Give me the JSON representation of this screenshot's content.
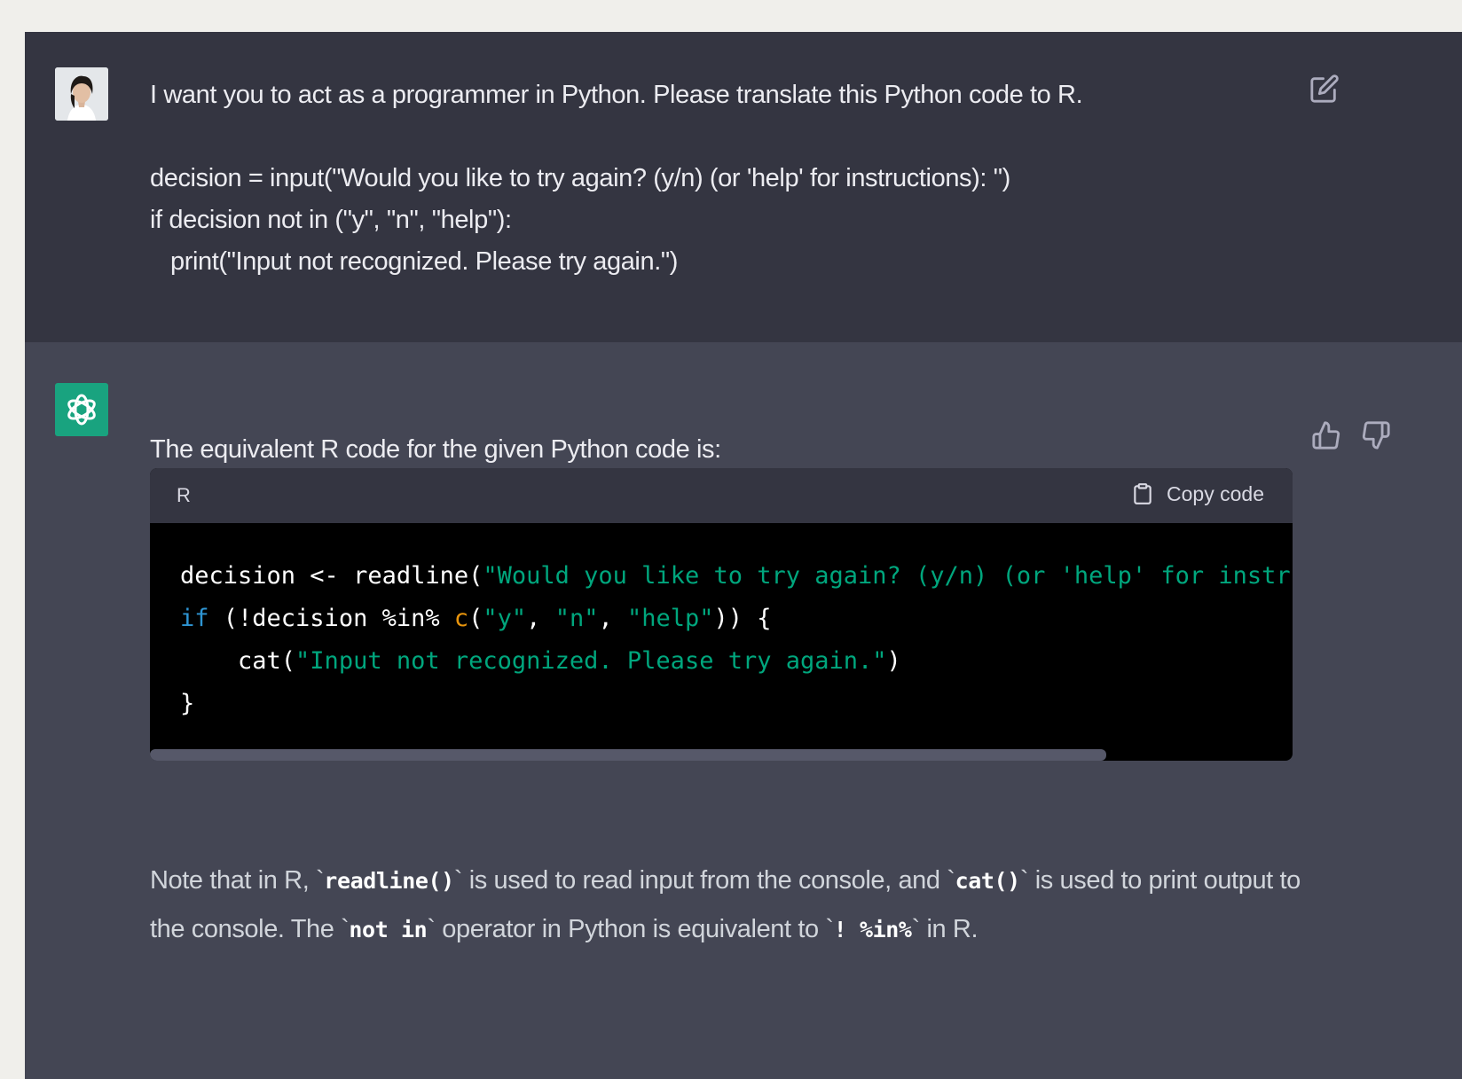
{
  "user_message": {
    "lines": [
      "I want you to act as a programmer in Python. Please translate this Python code to R.",
      "",
      "decision = input(\"Would you like to try again? (y/n) (or 'help' for instructions): \")",
      "if decision not in (\"y\", \"n\", \"help\"):",
      "   print(\"Input not recognized. Please try again.\")"
    ]
  },
  "assistant_message": {
    "intro": "The equivalent R code for the given Python code is:",
    "code_block": {
      "language": "R",
      "copy_label": "Copy code",
      "tokens": {
        "l1a": "decision <- readline(",
        "l1b": "\"Would you like to try again? (y/n) (or 'help' for instructions): \"",
        "l1c": ")",
        "l2a": "if",
        "l2b": " (!decision %in% ",
        "l2c": "c",
        "l2d": "(",
        "l2e": "\"y\"",
        "l2f": ", ",
        "l2g": "\"n\"",
        "l2h": ", ",
        "l2i": "\"help\"",
        "l2j": ")) {",
        "l3a": "    cat(",
        "l3b": "\"Input not recognized. Please try again.\"",
        "l3c": ")",
        "l4": "}"
      },
      "scrollbar_fraction": 0.837
    },
    "note": {
      "t1": "Note that in R, `",
      "c1": "readline()",
      "t2": "` is used to read input from the console, and `",
      "c2": "cat()",
      "t3": "` is used to print output to the console. The `",
      "c3": "not in",
      "t4": "` operator in Python is equivalent to `",
      "c4": "! %in%",
      "t5": "` in R."
    }
  },
  "icons": {
    "edit": "edit-icon",
    "thumbs_up": "thumbs-up-icon",
    "thumbs_down": "thumbs-down-icon",
    "clipboard": "clipboard-icon",
    "bot_logo": "openai-logo-icon",
    "user_avatar": "user-avatar-photo"
  },
  "colors": {
    "user_bg": "#343541",
    "assistant_bg": "#444654",
    "bot_avatar_bg": "#19a37f",
    "code_string": "#00a67d",
    "code_keyword": "#2e95d3"
  }
}
